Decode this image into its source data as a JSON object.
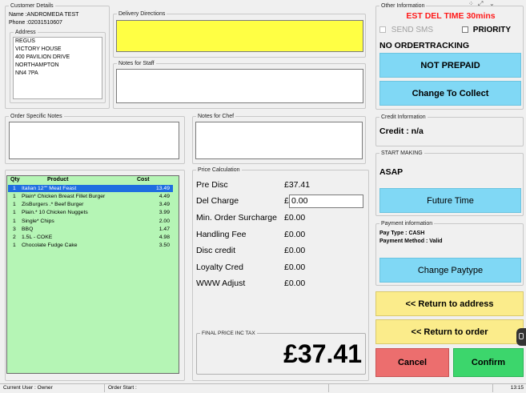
{
  "customer": {
    "legend": "Customer Details",
    "name_line": "Name :ANDROMEDA TEST",
    "phone_line": "Phone :02031510607",
    "address_legend": "Address",
    "address_lines": [
      "REGUS",
      "VICTORY HOUSE",
      "400 PAVILION DRIVE",
      "NORTHAMPTON",
      "NN4 7PA"
    ]
  },
  "delivery_directions": {
    "legend": "Delivery Directions",
    "value": ""
  },
  "notes_staff": {
    "legend": "Notes for Staff",
    "value": ""
  },
  "order_notes": {
    "legend": "Order Specific Notes",
    "value": ""
  },
  "notes_chef": {
    "legend": "Notes for Chef",
    "value": ""
  },
  "other_info": {
    "legend": "Other Information",
    "est_time": "EST DEL TIME 30mins",
    "send_sms": "SEND SMS",
    "priority": "PRIORITY",
    "tracking": "NO ORDERTRACKING",
    "not_prepaid": "NOT PREPAID",
    "change_collect": "Change To Collect"
  },
  "credit": {
    "legend": "Credit Information",
    "text": "Credit : n/a"
  },
  "start_making": {
    "legend": "START MAKING",
    "asap": "ASAP",
    "future_time": "Future Time"
  },
  "payment": {
    "legend": "Payment information",
    "pay_type": "Pay Type : CASH",
    "pay_method": "Payment Method : Valid",
    "change_paytype": "Change Paytype"
  },
  "order": {
    "headers": {
      "qty": "Qty",
      "product": "Product",
      "cost": "Cost"
    },
    "items": [
      {
        "qty": "1",
        "product": "Italian 12\"\" Meat Feast",
        "cost": "13.49"
      },
      {
        "qty": "1",
        "product": "Plain* Chicken Breast Fillet Burger",
        "cost": "4.49"
      },
      {
        "qty": "1",
        "product": "ZisBurgers .* Beef Burger",
        "cost": "3.49"
      },
      {
        "qty": "1",
        "product": "Plain.* 10 Chicken Nuggets",
        "cost": "3.99"
      },
      {
        "qty": "1",
        "product": "Single* Chips",
        "cost": "2.00"
      },
      {
        "qty": "3",
        "product": "BBQ",
        "cost": "1.47"
      },
      {
        "qty": "2",
        "product": "1.5L - COKE",
        "cost": "4.98"
      },
      {
        "qty": "1",
        "product": "Chocolate Fudge Cake",
        "cost": "3.50"
      }
    ]
  },
  "price": {
    "legend": "Price Calculation",
    "rows": [
      {
        "label": "Pre Disc",
        "value": "£37.41"
      },
      {
        "label": "Del Charge",
        "value": "£"
      },
      {
        "label": "Min. Order Surcharge",
        "value": "£0.00"
      },
      {
        "label": "Handling Fee",
        "value": "£0.00"
      },
      {
        "label": "Disc credit",
        "value": "£0.00"
      },
      {
        "label": "Loyalty Cred",
        "value": "£0.00"
      },
      {
        "label": "WWW Adjust",
        "value": "£0.00"
      }
    ],
    "del_charge_input": "0.00",
    "final_legend": "FINAL PRICE INC TAX",
    "final_value": "£37.41"
  },
  "actions": {
    "return_address": "<< Return to address",
    "return_order": "<< Return to order",
    "cancel": "Cancel",
    "confirm": "Confirm"
  },
  "status": {
    "current_user": "Current User : Owner",
    "order_start": "Order Start :",
    "time": "13:15"
  },
  "colors": {
    "directions_bg": "#ffff44",
    "order_bg": "#b5f5b5",
    "selected_row": "#1f6ee0",
    "est_time": "#ff1a1a"
  }
}
